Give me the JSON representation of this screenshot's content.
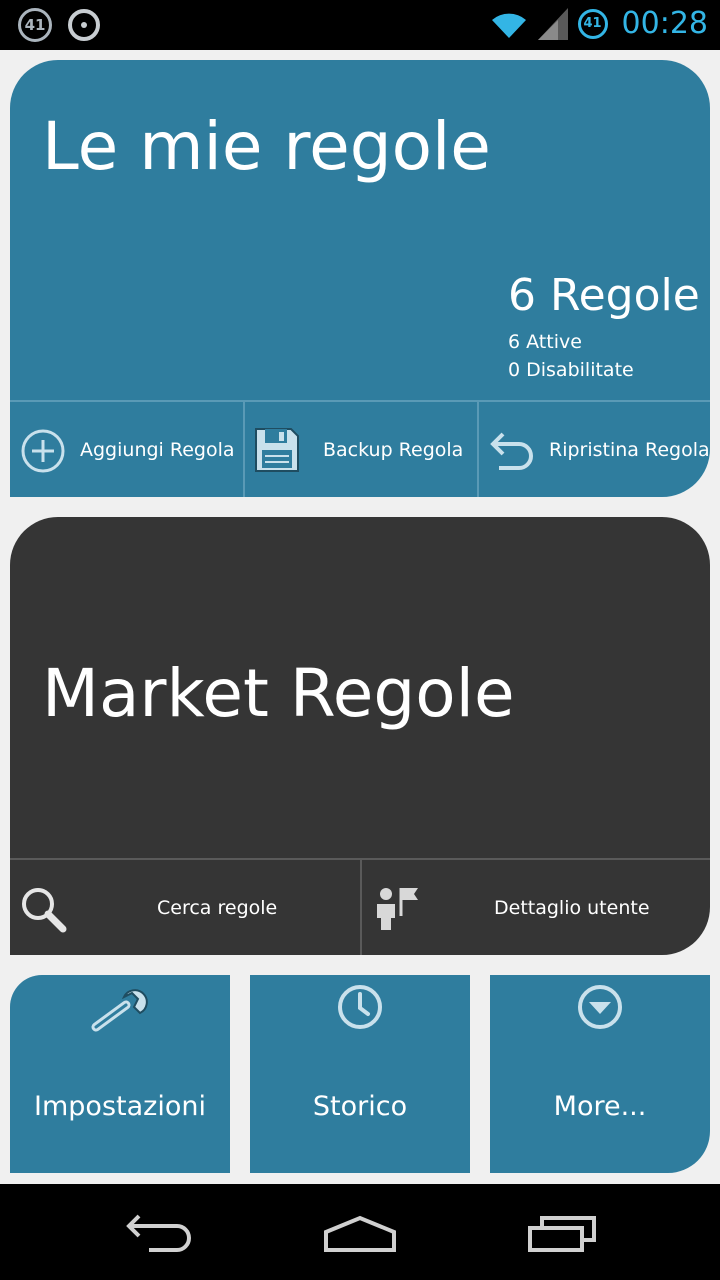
{
  "status_bar": {
    "left_badge": "41",
    "right_badge": "41",
    "time": "00:28",
    "icons": [
      "notification-41-icon",
      "sync-ring-icon",
      "wifi-icon",
      "signal-icon"
    ]
  },
  "rules_card": {
    "title": "Le mie regole",
    "count": "6 Regole",
    "active": "6 Attive",
    "disabled": "0 Disabilitate",
    "actions": [
      {
        "label": "Aggiungi Regola",
        "icon": "add-circle-icon"
      },
      {
        "label": "Backup Regola",
        "icon": "floppy-disk-icon"
      },
      {
        "label": "Ripristina Regola",
        "icon": "undo-arrow-icon"
      }
    ]
  },
  "market_card": {
    "title": "Market Regole",
    "actions": [
      {
        "label": "Cerca regole",
        "icon": "search-icon"
      },
      {
        "label": "Dettaglio utente",
        "icon": "user-flag-icon"
      }
    ]
  },
  "tiles": [
    {
      "label": "Impostazioni",
      "icon": "wrench-icon"
    },
    {
      "label": "Storico",
      "icon": "clock-icon"
    },
    {
      "label": "More...",
      "icon": "dropdown-circle-icon"
    }
  ],
  "nav": {
    "icons": [
      "back-icon",
      "home-icon",
      "recent-apps-icon"
    ]
  },
  "colors": {
    "blue_tile": "#2f7d9e",
    "dark_tile": "#353535",
    "status_accent": "#33b5e5"
  }
}
